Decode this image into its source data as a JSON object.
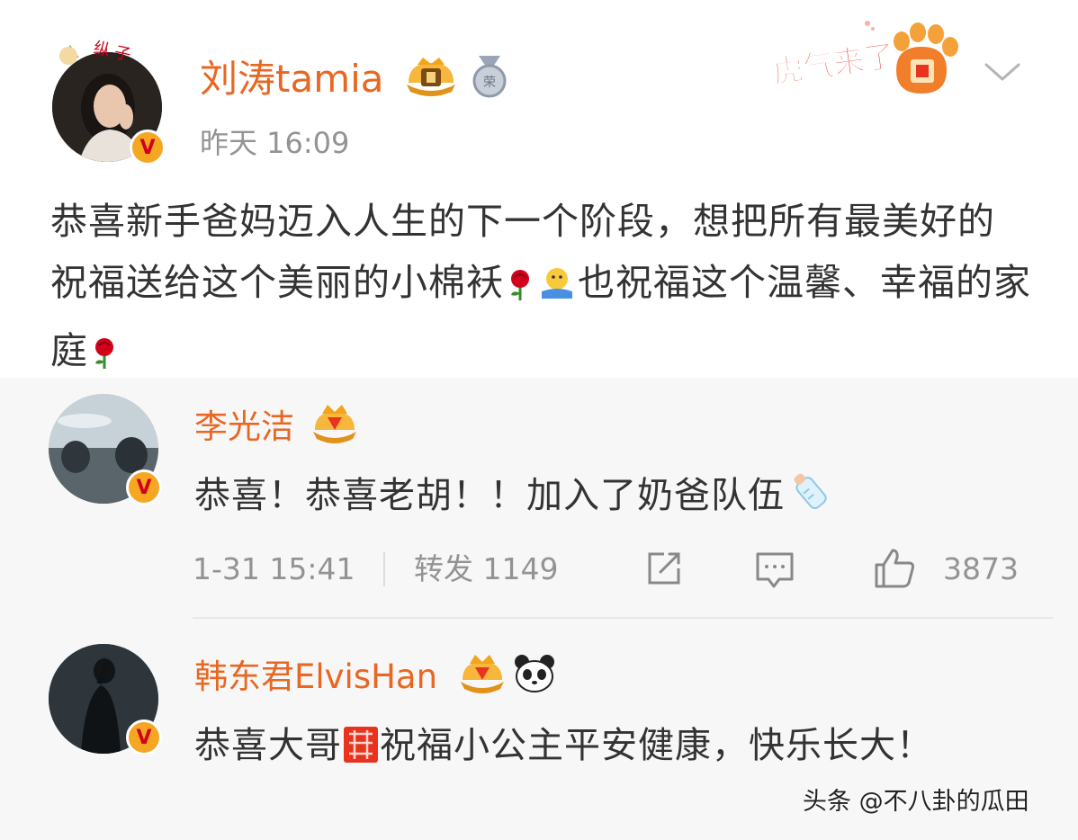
{
  "post": {
    "author": "刘涛tamia",
    "time": "昨天 16:09",
    "festive_label": "虎气来了",
    "text_part1": "恭喜新手爸妈迈入人生的下一个阶段，想把所有最美好的祝福送给这个美丽的小棉袄",
    "text_part2": "也祝福这个温馨、幸福的家庭",
    "colors": {
      "name": "#e86722",
      "text": "#333333",
      "time": "#939393"
    }
  },
  "comments": [
    {
      "name": "李光洁",
      "text": "恭喜！恭喜老胡！！加入了奶爸队伍",
      "date": "1-31 15:41",
      "repost_label": "转发",
      "repost_count": "1149",
      "like_count": "3873"
    },
    {
      "name": "韩东君ElvisHan",
      "text_part1": "恭喜大哥",
      "text_part2": "祝福小公主平安健康，快乐长大！"
    }
  ],
  "watermark": "头条 @不八卦的瓜田",
  "icons": [
    "crown-badge-icon",
    "medal-icon",
    "tiger-paw-icon",
    "chevron-down-icon",
    "rose-emoji-icon",
    "hug-emoji-icon",
    "baby-bottle-emoji-icon",
    "double-happiness-icon",
    "panda-icon",
    "share-icon",
    "comment-icon",
    "like-icon",
    "verified-v-icon"
  ]
}
